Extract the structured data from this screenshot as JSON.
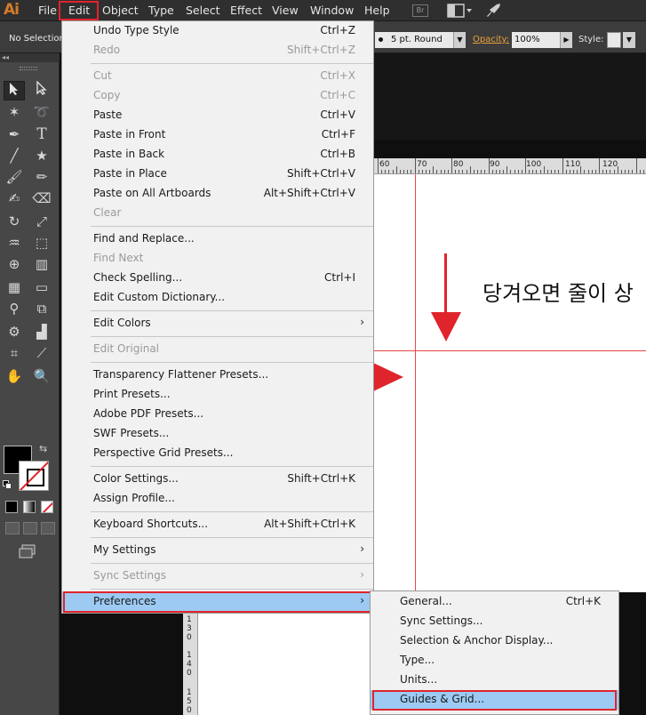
{
  "app": {
    "logo": "Ai",
    "bridge_badge": "Br"
  },
  "menubar": {
    "items": [
      "File",
      "Edit",
      "Object",
      "Type",
      "Select",
      "Effect",
      "View",
      "Window",
      "Help"
    ]
  },
  "controlbar": {
    "selection_status": "No Selection",
    "stroke_profile": "5 pt. Round",
    "opacity_label": "Opacity:",
    "opacity_value": "100%",
    "style_label": "Style:"
  },
  "edit_menu": {
    "items": [
      {
        "label": "Undo Type Style",
        "shortcut": "Ctrl+Z",
        "enabled": true
      },
      {
        "label": "Redo",
        "shortcut": "Shift+Ctrl+Z",
        "enabled": false
      },
      {
        "label": "Cut",
        "shortcut": "Ctrl+X",
        "enabled": false
      },
      {
        "label": "Copy",
        "shortcut": "Ctrl+C",
        "enabled": false
      },
      {
        "label": "Paste",
        "shortcut": "Ctrl+V",
        "enabled": true
      },
      {
        "label": "Paste in Front",
        "shortcut": "Ctrl+F",
        "enabled": true
      },
      {
        "label": "Paste in Back",
        "shortcut": "Ctrl+B",
        "enabled": true
      },
      {
        "label": "Paste in Place",
        "shortcut": "Shift+Ctrl+V",
        "enabled": true
      },
      {
        "label": "Paste on All Artboards",
        "shortcut": "Alt+Shift+Ctrl+V",
        "enabled": true
      },
      {
        "label": "Clear",
        "shortcut": "",
        "enabled": false
      },
      {
        "label": "Find and Replace...",
        "shortcut": "",
        "enabled": true
      },
      {
        "label": "Find Next",
        "shortcut": "",
        "enabled": false
      },
      {
        "label": "Check Spelling...",
        "shortcut": "Ctrl+I",
        "enabled": true
      },
      {
        "label": "Edit Custom Dictionary...",
        "shortcut": "",
        "enabled": true
      },
      {
        "label": "Edit Colors",
        "shortcut": "",
        "enabled": true,
        "submenu": true
      },
      {
        "label": "Edit Original",
        "shortcut": "",
        "enabled": false
      },
      {
        "label": "Transparency Flattener Presets...",
        "shortcut": "",
        "enabled": true
      },
      {
        "label": "Print Presets...",
        "shortcut": "",
        "enabled": true
      },
      {
        "label": "Adobe PDF Presets...",
        "shortcut": "",
        "enabled": true
      },
      {
        "label": "SWF Presets...",
        "shortcut": "",
        "enabled": true
      },
      {
        "label": "Perspective Grid Presets...",
        "shortcut": "",
        "enabled": true
      },
      {
        "label": "Color Settings...",
        "shortcut": "Shift+Ctrl+K",
        "enabled": true
      },
      {
        "label": "Assign Profile...",
        "shortcut": "",
        "enabled": true
      },
      {
        "label": "Keyboard Shortcuts...",
        "shortcut": "Alt+Shift+Ctrl+K",
        "enabled": true
      },
      {
        "label": "My Settings",
        "shortcut": "",
        "enabled": true,
        "submenu": true
      },
      {
        "label": "Sync Settings",
        "shortcut": "",
        "enabled": false,
        "submenu": true
      },
      {
        "label": "Preferences",
        "shortcut": "",
        "enabled": true,
        "submenu": true,
        "highlighted": true
      }
    ]
  },
  "preferences_menu": {
    "items": [
      {
        "label": "General...",
        "shortcut": "Ctrl+K"
      },
      {
        "label": "Sync Settings...",
        "shortcut": ""
      },
      {
        "label": "Selection & Anchor Display...",
        "shortcut": ""
      },
      {
        "label": "Type...",
        "shortcut": ""
      },
      {
        "label": "Units...",
        "shortcut": ""
      },
      {
        "label": "Guides & Grid...",
        "shortcut": "",
        "highlighted": true
      }
    ]
  },
  "ruler": {
    "h_labels": [
      "60",
      "70",
      "80",
      "90",
      "100",
      "110",
      "120"
    ],
    "v_digits": [
      "1",
      "3",
      "0",
      "1",
      "4",
      "0",
      "1",
      "5",
      "0"
    ]
  },
  "canvas": {
    "annotation_text": "당겨오면 줄이 상"
  },
  "colors": {
    "accent_red": "#e0242c",
    "menu_highlight": "#9ccaf3",
    "guide": "#e8484a",
    "brand": "#d47a2a"
  }
}
